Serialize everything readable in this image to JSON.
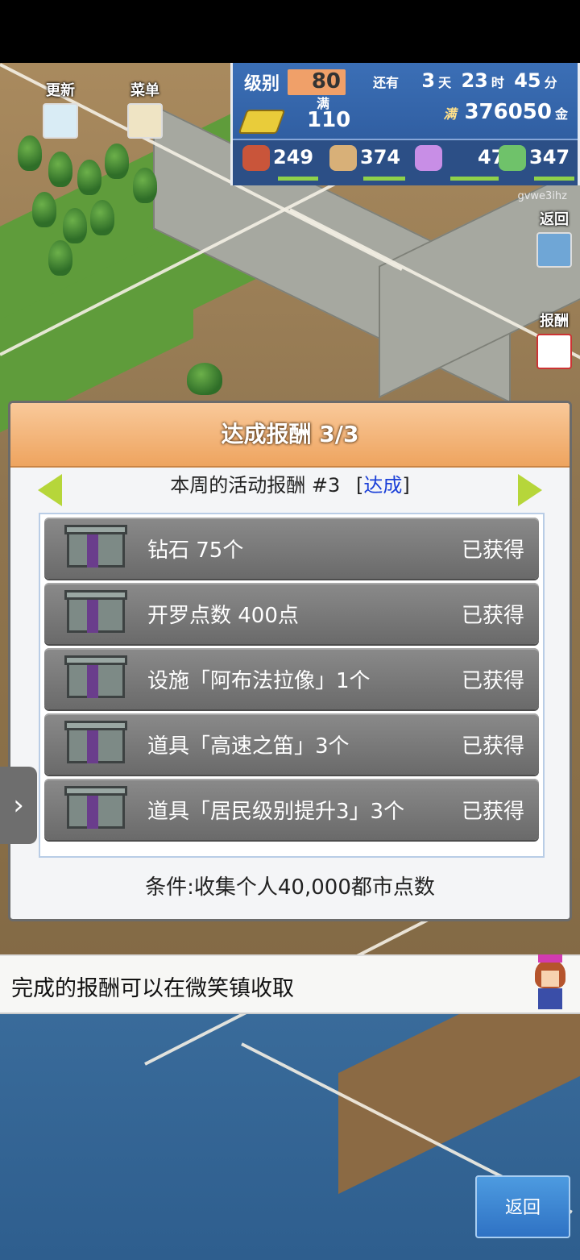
{
  "hud": {
    "level_label": "级别",
    "level_value": "80",
    "level_max": "满",
    "gold_amount": "110",
    "remaining_label": "还有",
    "days": "3",
    "days_unit": "天",
    "hours": "23",
    "hours_unit": "时",
    "minutes": "45",
    "minutes_unit": "分",
    "money_prefix": "满",
    "money": "376050",
    "money_unit": "金",
    "stats": [
      {
        "icon": "food-icon",
        "value": "249",
        "color": "#c9553a"
      },
      {
        "icon": "goods-bag-icon",
        "value": "374",
        "color": "#d8b078"
      },
      {
        "icon": "music-note-icon",
        "value": "47",
        "color": "#c88ee6"
      },
      {
        "icon": "book-icon",
        "value": "347",
        "color": "#6fc26a"
      }
    ]
  },
  "map_buttons": {
    "update": "更新",
    "menu": "菜单",
    "back": "返回",
    "reward": "报酬"
  },
  "user_tag": "gvwe3ihz",
  "dialog": {
    "title": "达成报酬 3/3",
    "subtitle": "本周的活动报酬 #3",
    "subtitle_open": "[",
    "subtitle_status": "达成",
    "subtitle_close": "]",
    "items": [
      {
        "name": "钻石 75个",
        "status": "已获得"
      },
      {
        "name": "开罗点数 400点",
        "status": "已获得"
      },
      {
        "name": "设施「阿布法拉像」1个",
        "status": "已获得"
      },
      {
        "name": "道具「高速之笛」3个",
        "status": "已获得"
      },
      {
        "name": "道具「居民级别提升3」3个",
        "status": "已获得"
      }
    ],
    "condition": "条件:收集个人40,000都市点数"
  },
  "side_tab": "›",
  "message": "完成的报酬可以在微笑镇收取",
  "back_button": "返回"
}
